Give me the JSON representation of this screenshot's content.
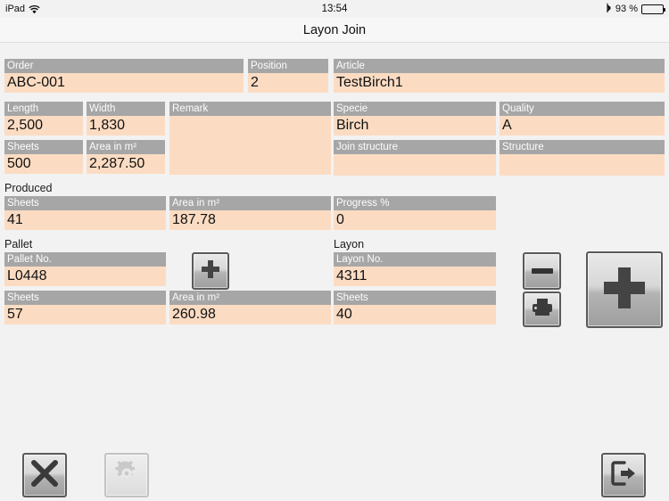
{
  "status_bar": {
    "device": "iPad",
    "wifi_icon": "wifi-icon",
    "time": "13:54",
    "bluetooth_icon": "bluetooth-icon",
    "battery_percent": "93 %",
    "battery_icon": "battery-icon",
    "battery_level": 93
  },
  "navbar": {
    "title": "Layon Join"
  },
  "order": {
    "order": {
      "label": "Order",
      "value": "ABC-001"
    },
    "position": {
      "label": "Position",
      "value": "2"
    },
    "article": {
      "label": "Article",
      "value": "TestBirch1"
    },
    "length": {
      "label": "Length",
      "value": "2,500"
    },
    "width": {
      "label": "Width",
      "value": "1,830"
    },
    "remark": {
      "label": "Remark",
      "value": ""
    },
    "specie": {
      "label": "Specie",
      "value": "Birch"
    },
    "quality": {
      "label": "Quality",
      "value": "A"
    },
    "sheets": {
      "label": "Sheets",
      "value": "500"
    },
    "area": {
      "label": "Area in m²",
      "value": "2,287.50"
    },
    "join_structure": {
      "label": "Join structure",
      "value": ""
    },
    "structure": {
      "label": "Structure",
      "value": ""
    }
  },
  "produced": {
    "title": "Produced",
    "sheets": {
      "label": "Sheets",
      "value": "41"
    },
    "area": {
      "label": "Area in m²",
      "value": "187.78"
    },
    "progress": {
      "label": "Progress %",
      "value": "0"
    }
  },
  "pallet": {
    "title": "Pallet",
    "pallet_no": {
      "label": "Pallet No.",
      "value": "L0448"
    },
    "sheets": {
      "label": "Sheets",
      "value": "57"
    },
    "area": {
      "label": "Area in m²",
      "value": "260.98"
    },
    "add_button": "add-pallet-button"
  },
  "layon": {
    "title": "Layon",
    "layon_no": {
      "label": "Layon No.",
      "value": "4311"
    },
    "sheets": {
      "label": "Sheets",
      "value": "40"
    },
    "minus_button": "remove-layon-button",
    "print_button": "print-button",
    "add_button": "add-layon-button"
  },
  "toolbar": {
    "close_button": "close-button",
    "settings_button": "settings-button",
    "settings_enabled": false,
    "exit_button": "exit-button"
  },
  "colors": {
    "label_bg": "#a6a6a6",
    "value_bg": "#fbdcc3",
    "page_bg": "#f2f2f2",
    "navbar_bg": "#f7f7f7"
  }
}
